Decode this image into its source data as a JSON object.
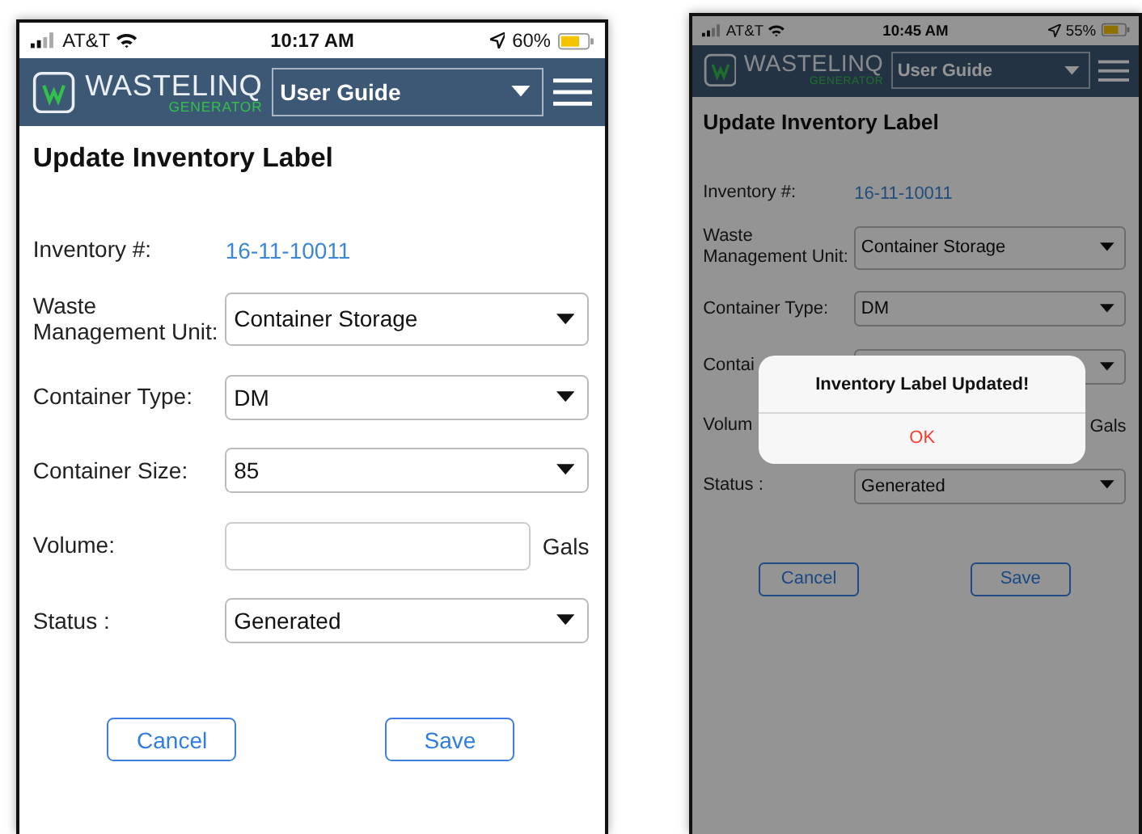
{
  "screens": [
    {
      "status_bar": {
        "carrier": "AT&T",
        "time": "10:17 AM",
        "battery": "60%"
      },
      "header": {
        "brand": "WASTELINQ",
        "subtitle": "GENERATOR",
        "dropdown": "User Guide"
      },
      "title": "Update Inventory Label",
      "fields": [
        {
          "kind": "text",
          "label": "Inventory #:",
          "value": "16-11-10011"
        },
        {
          "kind": "select",
          "label": "Waste Management Unit:",
          "value": "Container Storage"
        },
        {
          "kind": "select",
          "label": "Container Type:",
          "value": "DM"
        },
        {
          "kind": "select",
          "label": "Container Size:",
          "value": "85"
        },
        {
          "kind": "input",
          "label": "Volume:",
          "unit": "Gals"
        },
        {
          "kind": "select",
          "label": "Status :",
          "value": "Generated"
        }
      ],
      "buttons": [
        {
          "label": "Cancel"
        },
        {
          "label": "Save"
        }
      ],
      "dimmed": false
    },
    {
      "status_bar": {
        "carrier": "AT&T",
        "time": "10:45 AM",
        "battery": "55%"
      },
      "header": {
        "brand": "WASTELINQ",
        "subtitle": "GENERATOR",
        "dropdown": "User Guide"
      },
      "title": "Update Inventory Label",
      "fields": [
        {
          "kind": "text",
          "label": "Inventory #:",
          "value": "16-11-10011"
        },
        {
          "kind": "select",
          "label": "Waste Management Unit:",
          "value": "Container Storage"
        },
        {
          "kind": "select",
          "label": "Container Type:",
          "value": "DM"
        },
        {
          "kind": "select",
          "label": "Contai"
        },
        {
          "kind": "unit",
          "label": "Volum",
          "unit": "Gals"
        },
        {
          "kind": "select",
          "label": "Status :",
          "value": "Generated"
        }
      ],
      "buttons": [
        {
          "label": "Cancel"
        },
        {
          "label": "Save"
        }
      ],
      "dimmed": true,
      "alert": {
        "message": "Inventory Label Updated!",
        "action": "OK"
      }
    }
  ]
}
